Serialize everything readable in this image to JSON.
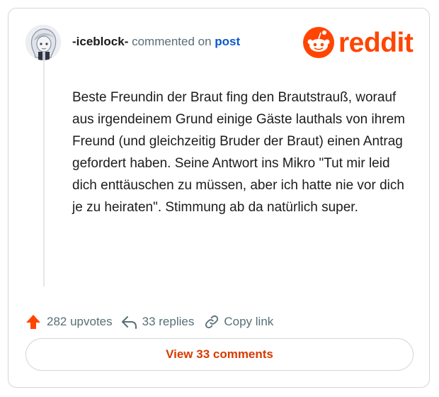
{
  "comment": {
    "username": "-iceblock-",
    "commented_on_text": "commented on",
    "post_link_text": "post",
    "body": "Beste Freundin der Braut fing den Brautstrauß, worauf aus irgendeinem Grund einige Gäste lauthals von ihrem Freund (und gleichzeitig Bruder der Braut) einen Antrag gefordert haben. Seine Antwort ins Mikro \"Tut mir leid dich enttäuschen zu müssen, aber ich hatte nie vor dich je zu heiraten\". Stimmung ab da natürlich super."
  },
  "logo": {
    "text": "reddit",
    "icon": "reddit-snoo-icon"
  },
  "actions": {
    "upvotes_label": "282 upvotes",
    "replies_label": "33 replies",
    "copy_link_label": "Copy link"
  },
  "footer": {
    "view_comments_label": "View 33 comments"
  },
  "icons": {
    "upvote": "upvote-arrow-icon",
    "reply": "reply-arrow-icon",
    "copy": "link-chain-icon",
    "avatar": "user-avatar"
  },
  "colors": {
    "brand": "#ff4500",
    "view_button_text": "#d93a00",
    "link": "#0a58ca",
    "muted": "#576f76"
  }
}
